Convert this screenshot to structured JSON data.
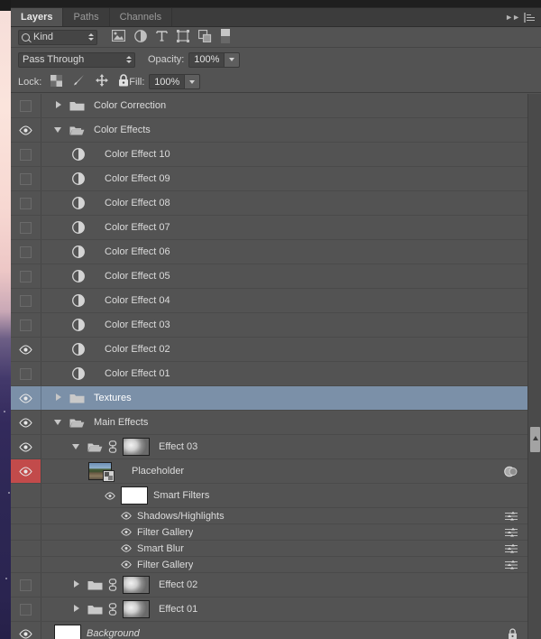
{
  "window": {
    "app": "Adobe Photoshop",
    "panel_title": "Layers"
  },
  "tabs": [
    {
      "label": "Layers",
      "active": true
    },
    {
      "label": "Paths",
      "active": false
    },
    {
      "label": "Channels",
      "active": false
    }
  ],
  "tab_controls": {
    "collapse_icon": "double-chevron-right-icon",
    "menu_icon": "panel-menu-icon"
  },
  "filter_bar": {
    "kind_label": "Kind",
    "search_icon": "search-icon",
    "icons": [
      {
        "name": "pixel-layer-filter-icon"
      },
      {
        "name": "adjustment-layer-filter-icon"
      },
      {
        "name": "type-layer-filter-icon"
      },
      {
        "name": "shape-layer-filter-icon"
      },
      {
        "name": "smart-object-filter-icon"
      },
      {
        "name": "filter-toggle-switch-icon"
      }
    ]
  },
  "blend_bar": {
    "blend_mode": "Pass Through",
    "opacity_label": "Opacity:",
    "opacity_value": "100%",
    "fill_label": "Fill:",
    "fill_value": "100%"
  },
  "lock_bar": {
    "label": "Lock:",
    "icons": [
      {
        "name": "lock-transparent-pixels-icon"
      },
      {
        "name": "lock-image-pixels-icon"
      },
      {
        "name": "lock-position-icon"
      },
      {
        "name": "lock-all-icon"
      }
    ]
  },
  "layers": [
    {
      "name": "Color Correction",
      "type": "group",
      "visible": false,
      "expanded": false,
      "indent": 0,
      "selected": false,
      "linked": false,
      "thumb": "none"
    },
    {
      "name": "Color Effects",
      "type": "group",
      "visible": true,
      "expanded": true,
      "indent": 0,
      "selected": false,
      "linked": false,
      "thumb": "none"
    },
    {
      "name": "Color Effect 10",
      "type": "adjustment",
      "visible": false,
      "indent": 1,
      "selected": false,
      "linked": false,
      "thumb": "adjustment"
    },
    {
      "name": "Color Effect 09",
      "type": "adjustment",
      "visible": false,
      "indent": 1,
      "selected": false,
      "linked": false,
      "thumb": "adjustment"
    },
    {
      "name": "Color Effect 08",
      "type": "adjustment",
      "visible": false,
      "indent": 1,
      "selected": false,
      "linked": false,
      "thumb": "adjustment"
    },
    {
      "name": "Color Effect 07",
      "type": "adjustment",
      "visible": false,
      "indent": 1,
      "selected": false,
      "linked": false,
      "thumb": "adjustment"
    },
    {
      "name": "Color Effect 06",
      "type": "adjustment",
      "visible": false,
      "indent": 1,
      "selected": false,
      "linked": false,
      "thumb": "adjustment"
    },
    {
      "name": "Color Effect 05",
      "type": "adjustment",
      "visible": false,
      "indent": 1,
      "selected": false,
      "linked": false,
      "thumb": "adjustment"
    },
    {
      "name": "Color Effect 04",
      "type": "adjustment",
      "visible": false,
      "indent": 1,
      "selected": false,
      "linked": false,
      "thumb": "adjustment"
    },
    {
      "name": "Color Effect 03",
      "type": "adjustment",
      "visible": false,
      "indent": 1,
      "selected": false,
      "linked": false,
      "thumb": "adjustment"
    },
    {
      "name": "Color Effect 02",
      "type": "adjustment",
      "visible": true,
      "indent": 1,
      "selected": false,
      "linked": false,
      "thumb": "adjustment"
    },
    {
      "name": "Color Effect 01",
      "type": "adjustment",
      "visible": false,
      "indent": 1,
      "selected": false,
      "linked": false,
      "thumb": "adjustment"
    },
    {
      "name": "Textures",
      "type": "group",
      "visible": true,
      "expanded": false,
      "indent": 0,
      "selected": true,
      "linked": false,
      "thumb": "none"
    },
    {
      "name": "Main Effects",
      "type": "group",
      "visible": true,
      "expanded": true,
      "indent": 0,
      "selected": false,
      "linked": false,
      "thumb": "none"
    },
    {
      "name": "Effect 03",
      "type": "group",
      "visible": true,
      "expanded": true,
      "indent": 1,
      "selected": false,
      "linked": true,
      "thumb": "mask-gray"
    },
    {
      "name": "Placeholder",
      "type": "smart",
      "visible": true,
      "indent": 2,
      "selected": false,
      "linked": false,
      "thumb": "photo",
      "eye_highlight": true,
      "right_icon": "adjustment-badge-icon"
    },
    {
      "name": "Smart Filters",
      "type": "smartfilters",
      "visible": true,
      "indent": 3,
      "selected": false,
      "linked": false,
      "thumb": "white"
    },
    {
      "name": "Shadows/Highlights",
      "type": "filter",
      "visible": true,
      "indent": 4,
      "selected": false,
      "right_icon": "filter-settings-icon"
    },
    {
      "name": "Filter Gallery",
      "type": "filter",
      "visible": true,
      "indent": 4,
      "selected": false,
      "right_icon": "filter-settings-icon"
    },
    {
      "name": "Smart Blur",
      "type": "filter",
      "visible": true,
      "indent": 4,
      "selected": false,
      "right_icon": "filter-settings-icon"
    },
    {
      "name": "Filter Gallery",
      "type": "filter",
      "visible": true,
      "indent": 4,
      "selected": false,
      "right_icon": "filter-settings-icon"
    },
    {
      "name": "Effect 02",
      "type": "group",
      "visible": false,
      "expanded": false,
      "indent": 1,
      "selected": false,
      "linked": true,
      "thumb": "mask-gray"
    },
    {
      "name": "Effect 01",
      "type": "group",
      "visible": false,
      "expanded": false,
      "indent": 1,
      "selected": false,
      "linked": true,
      "thumb": "mask-gray"
    },
    {
      "name": "Background",
      "type": "background",
      "visible": true,
      "indent": 0,
      "selected": false,
      "linked": false,
      "thumb": "white",
      "italic": true,
      "right_icon": "lock-icon"
    }
  ],
  "scrollbar": {
    "name": "vertical-scrollbar",
    "thumb_position_pct": 64
  },
  "colors": {
    "panel_bg": "#535353",
    "tab_bg": "#3c3c3c",
    "selection": "#7b90a8",
    "eye_highlight": "#c24b4b",
    "text": "#dcdcdc"
  }
}
